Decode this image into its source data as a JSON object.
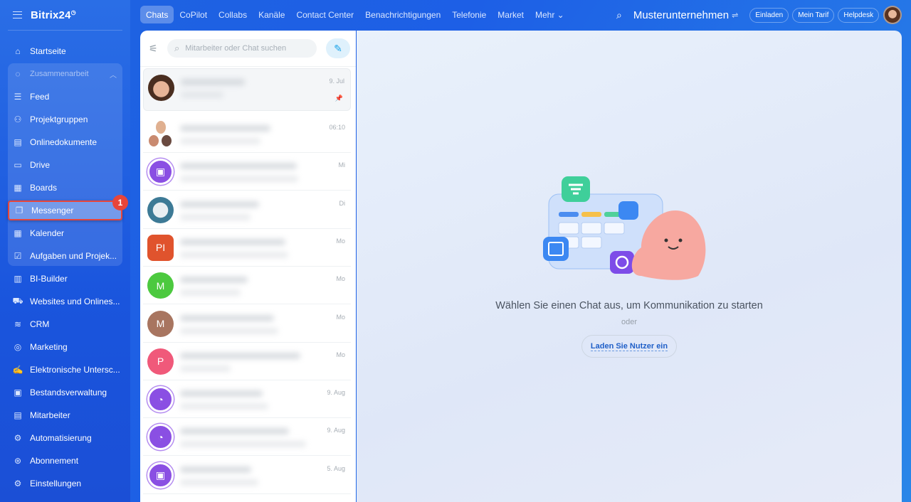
{
  "app": {
    "logo": "Bitrix24",
    "company": "Musterunternehmen"
  },
  "sidebar": {
    "items": [
      {
        "label": "Startseite",
        "icon": "home-icon"
      },
      {
        "label": "Zusammenarbeit",
        "icon": "collab-icon",
        "section": true
      },
      {
        "label": "Feed",
        "icon": "feed-icon"
      },
      {
        "label": "Projektgruppen",
        "icon": "groups-icon"
      },
      {
        "label": "Onlinedokumente",
        "icon": "document-icon"
      },
      {
        "label": "Drive",
        "icon": "drive-icon"
      },
      {
        "label": "Boards",
        "icon": "board-icon"
      },
      {
        "label": "Messenger",
        "icon": "chat-icon",
        "active": true
      },
      {
        "label": "Kalender",
        "icon": "calendar-icon"
      },
      {
        "label": "Aufgaben und Projek...",
        "icon": "tasks-icon"
      },
      {
        "label": "BI-Builder",
        "icon": "chart-icon"
      },
      {
        "label": "Websites und Onlines...",
        "icon": "cart-icon"
      },
      {
        "label": "CRM",
        "icon": "crm-icon"
      },
      {
        "label": "Marketing",
        "icon": "marketing-icon"
      },
      {
        "label": "Elektronische Untersc...",
        "icon": "signature-icon"
      },
      {
        "label": "Bestandsverwaltung",
        "icon": "inventory-icon"
      },
      {
        "label": "Mitarbeiter",
        "icon": "employees-icon"
      },
      {
        "label": "Automatisierung",
        "icon": "automation-icon"
      },
      {
        "label": "Abonnement",
        "icon": "subscription-icon"
      },
      {
        "label": "Einstellungen",
        "icon": "settings-icon"
      }
    ],
    "badge": "1"
  },
  "topnav": {
    "tabs": [
      "Chats",
      "CoPilot",
      "Collabs",
      "Kanäle",
      "Contact Center",
      "Benachrichtigungen",
      "Telefonie",
      "Market",
      "Mehr ⌄"
    ],
    "buttons": [
      "Einladen",
      "Mein Tarif",
      "Helpdesk"
    ]
  },
  "chats": {
    "search_placeholder": "Mitarbeiter oder Chat suchen",
    "rows": [
      {
        "date": "9. Jul",
        "avatar": "photo",
        "pinned": true
      },
      {
        "date": "06:10",
        "avatar": "group"
      },
      {
        "date": "Mi",
        "avatar": "purple-book"
      },
      {
        "date": "Di",
        "avatar": "cat"
      },
      {
        "date": "Mo",
        "avatar": "PI",
        "color": "#e0532d"
      },
      {
        "date": "Mo",
        "avatar": "M",
        "color": "#4cc93f"
      },
      {
        "date": "Mo",
        "avatar": "M",
        "color": "#a87560"
      },
      {
        "date": "Mo",
        "avatar": "P",
        "color": "#f0597a"
      },
      {
        "date": "9. Aug",
        "avatar": "purple-copilot"
      },
      {
        "date": "9. Aug",
        "avatar": "purple-copilot"
      },
      {
        "date": "5. Aug",
        "avatar": "purple-book"
      }
    ]
  },
  "main": {
    "empty_title": "Wählen Sie einen Chat aus, um Kommunikation zu starten",
    "or": "oder",
    "load_button": "Laden Sie Nutzer ein"
  }
}
